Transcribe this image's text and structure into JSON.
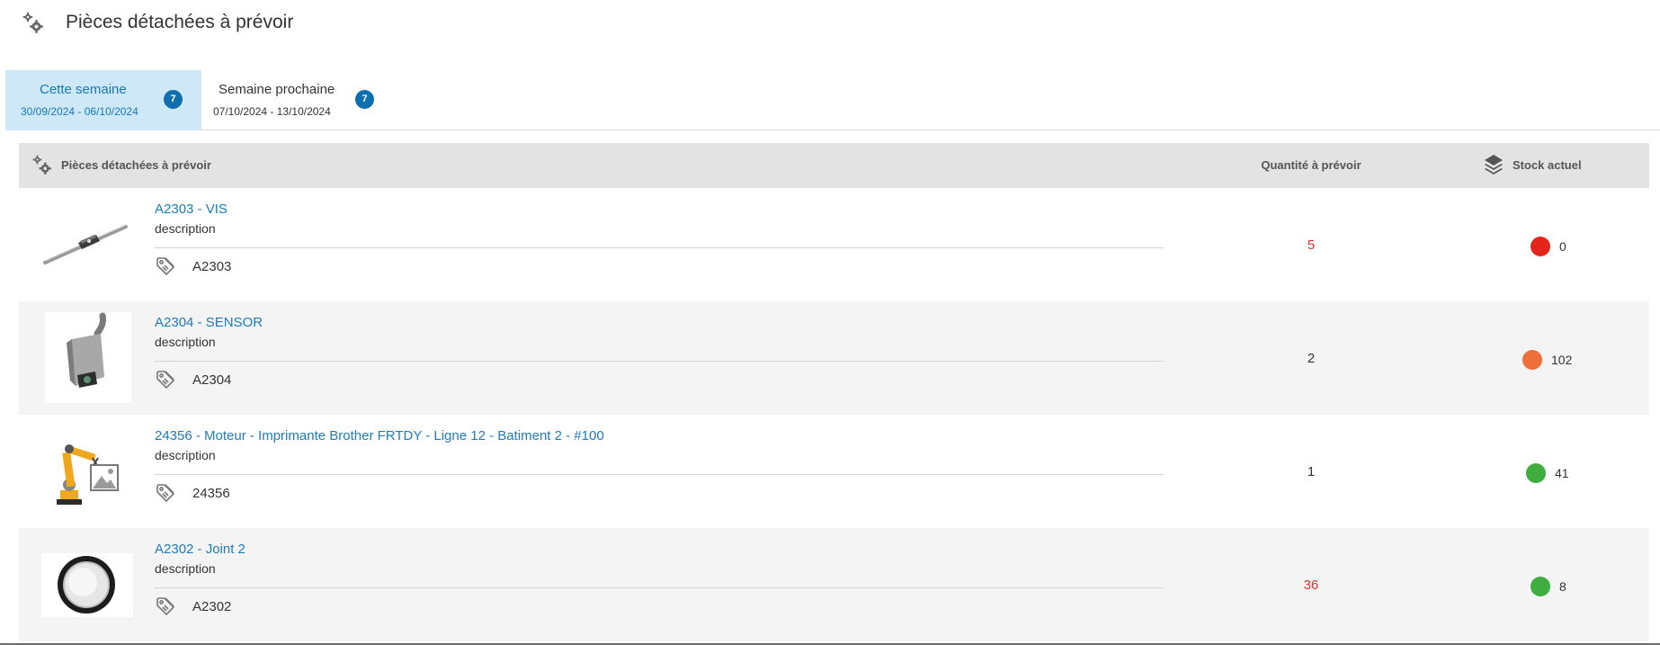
{
  "header": {
    "title": "Pièces détachées à prévoir",
    "icon": "gears-icon"
  },
  "tabs": [
    {
      "label": "Cette semaine",
      "dates": "30/09/2024 - 06/10/2024",
      "count": "7",
      "active": true
    },
    {
      "label": "Semaine prochaine",
      "dates": "07/10/2024 - 13/10/2024",
      "count": "7",
      "active": false
    }
  ],
  "table": {
    "columns": {
      "parts": "Pièces détachées à prévoir",
      "quantity": "Quantité à prévoir",
      "stock": "Stock actuel"
    },
    "rows": [
      {
        "title": "A2303 - VIS",
        "description": "description",
        "ref": "A2303",
        "quantity": "5",
        "quantity_color": "#d9342b",
        "stock": "0",
        "stock_color": "#e4251b",
        "image": "linear-rail-image"
      },
      {
        "title": "A2304 - SENSOR",
        "description": "description",
        "ref": "A2304",
        "quantity": "2",
        "quantity_color": "#333333",
        "stock": "102",
        "stock_color": "#ef6f3c",
        "image": "sensor-image"
      },
      {
        "title": "24356 - Moteur - Imprimante Brother FRTDY - Ligne 12 - Batiment 2 - #100",
        "description": "description",
        "ref": "24356",
        "quantity": "1",
        "quantity_color": "#333333",
        "stock": "41",
        "stock_color": "#3fae3f",
        "image": "robot-arm-image"
      },
      {
        "title": "A2302 - Joint 2",
        "description": "description",
        "ref": "A2302",
        "quantity": "36",
        "quantity_color": "#d9342b",
        "stock": "8",
        "stock_color": "#3fae3f",
        "image": "joint-image"
      }
    ]
  }
}
